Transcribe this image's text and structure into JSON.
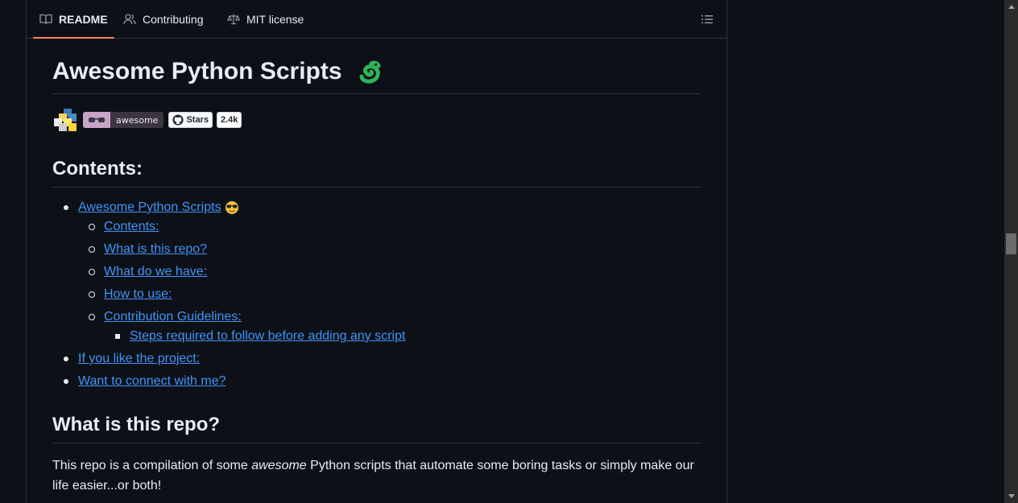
{
  "tabs": [
    {
      "label": "README",
      "icon": "book-icon",
      "active": true
    },
    {
      "label": "Contributing",
      "icon": "people-icon",
      "active": false
    },
    {
      "label": "MIT license",
      "icon": "law-icon",
      "active": false
    }
  ],
  "toc_button_icon": "list-icon",
  "readme": {
    "title": "Awesome Python Scripts",
    "title_icon": "snake-emoji-icon",
    "badges": {
      "python_logo": "python-logo-icon",
      "awesome_label": "awesome",
      "stars_label": "Stars",
      "stars_count": "2.4k"
    },
    "contents_heading": "Contents:",
    "toc": {
      "item1": "Awesome Python Scripts",
      "item1_emoji": "sunglasses-emoji-icon",
      "sub1": "Contents:",
      "sub2": "What is this repo?",
      "sub3": "What do we have:",
      "sub4": "How to use:",
      "sub5": "Contribution Guidelines:",
      "subsub1": "Steps required to follow before adding any script",
      "item2": "If you like the project:",
      "item3": "Want to connect with me?"
    },
    "repo_heading": "What is this repo?",
    "intro": {
      "before": "This repo is a compilation of some ",
      "em": "awesome",
      "after": " Python scripts that automate some boring tasks or simply make our life easier...or both!"
    }
  },
  "colors": {
    "background": "#0d1117",
    "link": "#4493f8",
    "active_tab_underline": "#f78166",
    "border": "#30363d"
  }
}
